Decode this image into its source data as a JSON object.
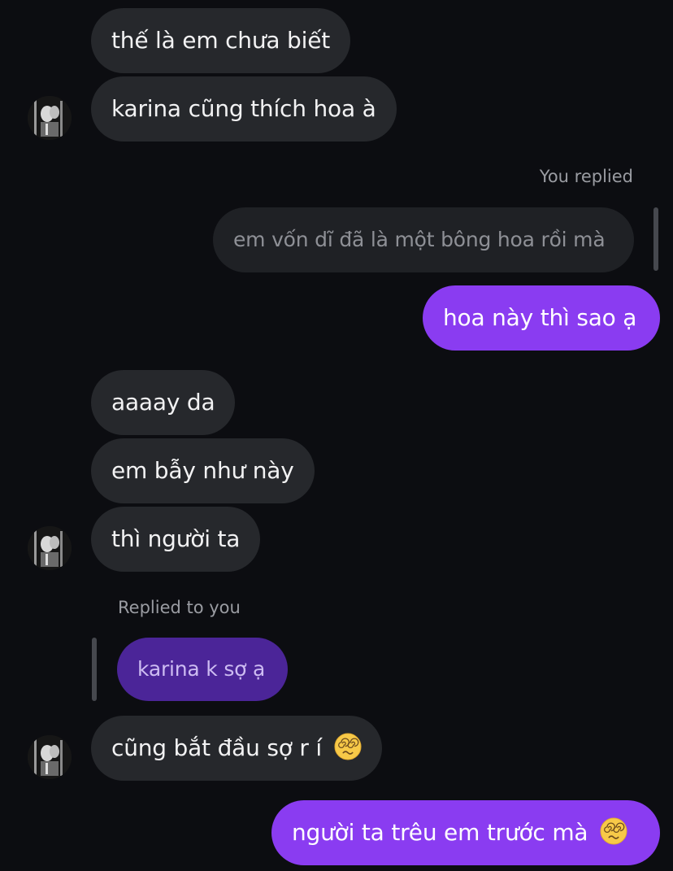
{
  "conversation": {
    "messages": [
      {
        "text": "thế là em chưa biết"
      },
      {
        "text": "karina cũng thích hoa à"
      },
      {
        "text": "em vốn dĩ đã là một bông hoa rồi mà"
      },
      {
        "text": "hoa này thì sao ạ"
      },
      {
        "text": "aaaay da"
      },
      {
        "text": "em bẫy như này"
      },
      {
        "text": "thì người ta"
      },
      {
        "text": "karina k sợ ạ"
      },
      {
        "text": "cũng bắt đầu sợ r í"
      },
      {
        "text": "người ta trêu em trước mà"
      }
    ],
    "reply_labels": {
      "you_replied": "You replied",
      "replied_to_you": "Replied to you"
    },
    "emoji": {
      "name": "face-with-spiral-eyes-icon"
    }
  },
  "colors": {
    "background": "#0c0d11",
    "incoming_bubble": "#26282c",
    "outgoing_bubble": "#8a3cf1",
    "quoted_outgoing_bubble": "#4b2598",
    "quoted_incoming_bubble": "#1f2125"
  }
}
